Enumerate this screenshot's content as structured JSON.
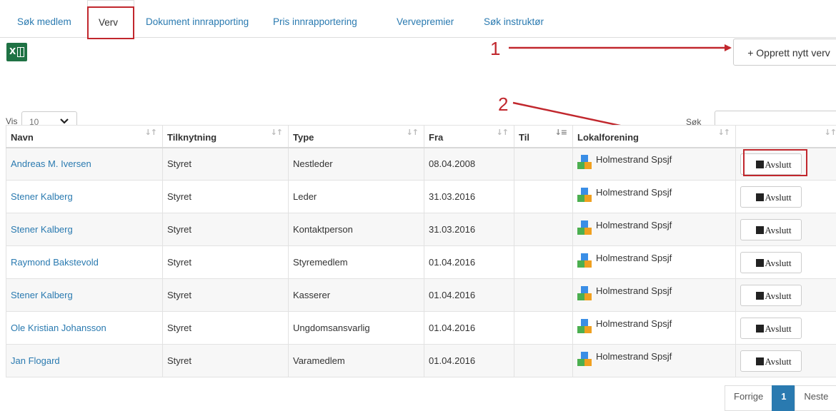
{
  "nav": {
    "tabs": [
      {
        "label": "Søk medlem"
      },
      {
        "label": "Verv"
      },
      {
        "label": "Dokument innrapporting"
      },
      {
        "label": "Pris innrapportering"
      },
      {
        "label": "Vervepremier"
      },
      {
        "label": "Søk instruktør"
      }
    ],
    "active_tab": "Verv"
  },
  "toolbar": {
    "export_icon": "excel-icon",
    "create_button": "+ Opprett nytt verv"
  },
  "annotations": {
    "one": "1",
    "two": "2",
    "color": "#c1272d"
  },
  "length": {
    "label": "Vis",
    "value": "10"
  },
  "search": {
    "label": "Søk",
    "value": ""
  },
  "table": {
    "headers": [
      "Navn",
      "Tilknytning",
      "Type",
      "Fra",
      "Til",
      "Lokalforening",
      ""
    ],
    "rows": [
      {
        "navn": "Andreas M. Iversen",
        "tilknytning": "Styret",
        "type": "Nestleder",
        "fra": "08.04.2008",
        "til": "",
        "lokalforening": "Holmestrand Spsjf",
        "action": "Avslutt"
      },
      {
        "navn": "Stener Kalberg",
        "tilknytning": "Styret",
        "type": "Leder",
        "fra": "31.03.2016",
        "til": "",
        "lokalforening": "Holmestrand Spsjf",
        "action": "Avslutt"
      },
      {
        "navn": "Stener Kalberg",
        "tilknytning": "Styret",
        "type": "Kontaktperson",
        "fra": "31.03.2016",
        "til": "",
        "lokalforening": "Holmestrand Spsjf",
        "action": "Avslutt"
      },
      {
        "navn": "Raymond Bakstevold",
        "tilknytning": "Styret",
        "type": "Styremedlem",
        "fra": "01.04.2016",
        "til": "",
        "lokalforening": "Holmestrand Spsjf",
        "action": "Avslutt"
      },
      {
        "navn": "Stener Kalberg",
        "tilknytning": "Styret",
        "type": "Kasserer",
        "fra": "01.04.2016",
        "til": "",
        "lokalforening": "Holmestrand Spsjf",
        "action": "Avslutt"
      },
      {
        "navn": "Ole Kristian Johansson",
        "tilknytning": "Styret",
        "type": "Ungdomsansvarlig",
        "fra": "01.04.2016",
        "til": "",
        "lokalforening": "Holmestrand Spsjf",
        "action": "Avslutt"
      },
      {
        "navn": "Jan Flogard",
        "tilknytning": "Styret",
        "type": "Varamedlem",
        "fra": "01.04.2016",
        "til": "",
        "lokalforening": "Holmestrand Spsjf",
        "action": "Avslutt"
      }
    ]
  },
  "pagination": {
    "prev": "Forrige",
    "current": "1",
    "next": "Neste"
  },
  "colors": {
    "link": "#2a7ab0",
    "annotation": "#c1272d",
    "excel": "#1f7244"
  }
}
